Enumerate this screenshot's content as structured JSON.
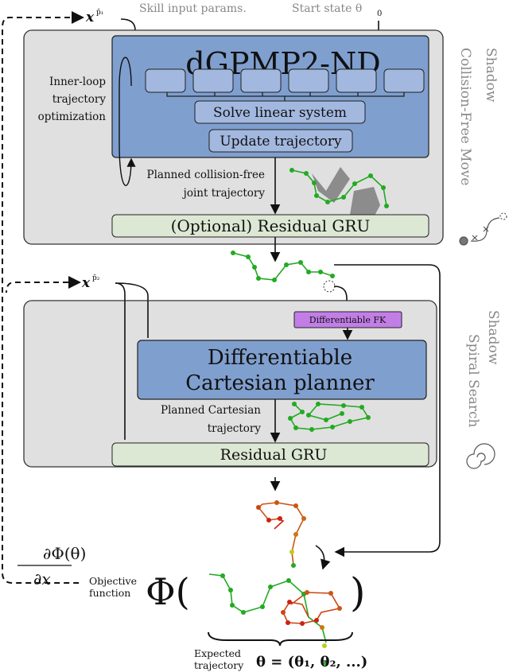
{
  "top_labels": {
    "skill_input": "Skill input params.",
    "start_state": "Start state θ",
    "start_state_sub": "0",
    "xp1": "x",
    "xp1_sup": "p̄₁",
    "xp2": "x",
    "xp2_sup": "p̄₂"
  },
  "block1": {
    "title": "dGPMP2-ND",
    "solve": "Solve linear system",
    "update": "Update trajectory",
    "inner_loop": [
      "Inner-loop",
      "trajectory",
      "optimization"
    ],
    "planned": [
      "Planned collision-free",
      "joint trajectory"
    ],
    "gru": "(Optional) Residual GRU",
    "side_label": [
      "Shadow",
      "Collision-Free Move"
    ]
  },
  "block2": {
    "fk": "Differentiable FK",
    "planner": [
      "Differentiable",
      "Cartesian planner"
    ],
    "planned": [
      "Planned Cartesian",
      "trajectory"
    ],
    "gru": "Residual GRU",
    "side_label": [
      "Shadow",
      "Spiral Search"
    ]
  },
  "bottom": {
    "gradient_num": "∂Φ(θ)",
    "gradient_den": "∂x",
    "objective": [
      "Objective",
      "function"
    ],
    "phi": "Φ(",
    "close_paren": ")",
    "expected": [
      "Expected",
      "trajectory"
    ],
    "theta_eq": "θ = (θ₁, θ₂, ...)"
  },
  "colors": {
    "outer_box": "#e0e0e0",
    "planner_blue": "#7f9fcf",
    "sub_box_blue": "#a3b8df",
    "gru_green": "#dde8d4",
    "fk_purple": "#c27ee6",
    "trajectory_green": "#22aa22",
    "trajectory_red": "#cc2211"
  }
}
